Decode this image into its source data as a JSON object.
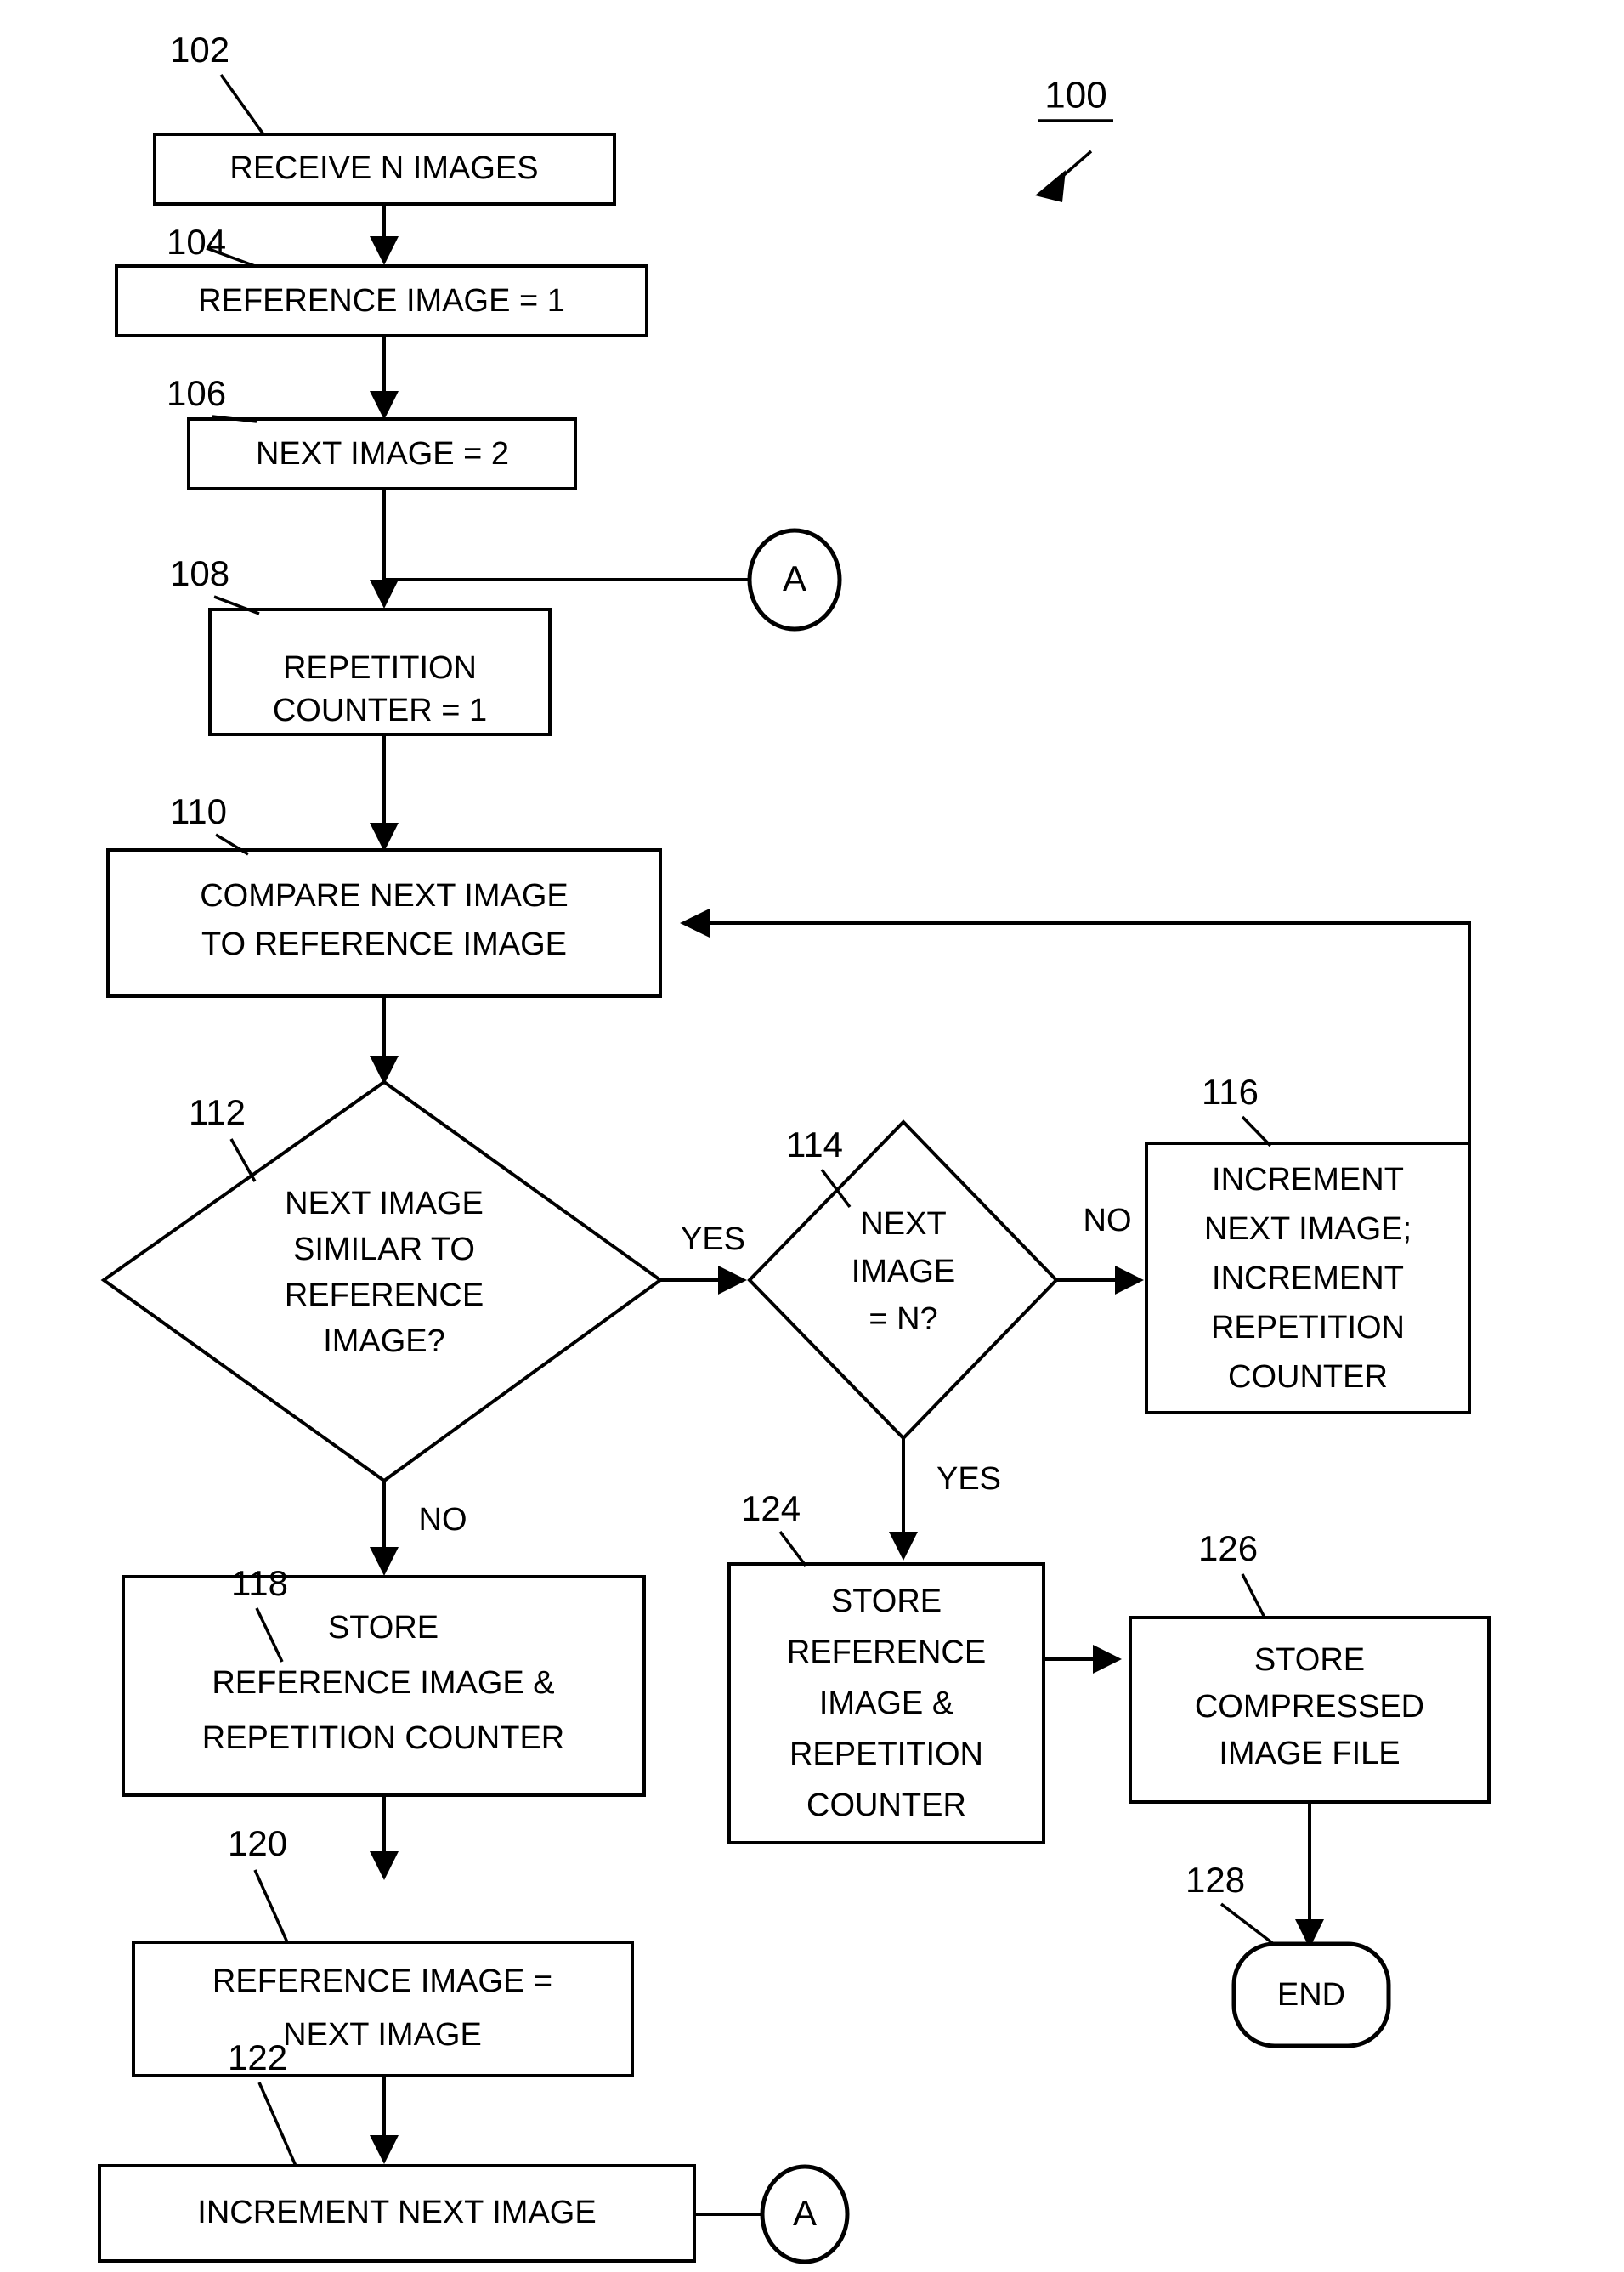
{
  "figure": {
    "number": "100",
    "underline": true
  },
  "nodes": [
    {
      "id": "n102",
      "ref": "102",
      "shape": "process",
      "lines": [
        "RECEIVE N IMAGES"
      ]
    },
    {
      "id": "n104",
      "ref": "104",
      "shape": "process",
      "lines": [
        "REFERENCE IMAGE = 1"
      ]
    },
    {
      "id": "n106",
      "ref": "106",
      "shape": "process",
      "lines": [
        "NEXT IMAGE = 2"
      ]
    },
    {
      "id": "n108",
      "ref": "108",
      "shape": "process",
      "lines": [
        "REPETITION",
        "COUNTER = 1"
      ]
    },
    {
      "id": "n110",
      "ref": "110",
      "shape": "process",
      "lines": [
        "COMPARE NEXT IMAGE",
        "TO REFERENCE IMAGE"
      ]
    },
    {
      "id": "n112",
      "ref": "112",
      "shape": "decision",
      "lines": [
        "NEXT IMAGE",
        "SIMILAR TO",
        "REFERENCE",
        "IMAGE?"
      ]
    },
    {
      "id": "n114",
      "ref": "114",
      "shape": "decision",
      "lines": [
        "NEXT",
        "IMAGE",
        "= N?"
      ]
    },
    {
      "id": "n116",
      "ref": "116",
      "shape": "process",
      "lines": [
        "INCREMENT",
        "NEXT IMAGE;",
        "INCREMENT",
        "REPETITION",
        "COUNTER"
      ]
    },
    {
      "id": "n118",
      "ref": "118",
      "shape": "process",
      "lines": [
        "STORE",
        "REFERENCE IMAGE &",
        "REPETITION COUNTER"
      ]
    },
    {
      "id": "n120",
      "ref": "120",
      "shape": "process",
      "lines": [
        "REFERENCE IMAGE =",
        "NEXT IMAGE"
      ]
    },
    {
      "id": "n122",
      "ref": "122",
      "shape": "process",
      "lines": [
        "INCREMENT NEXT IMAGE"
      ]
    },
    {
      "id": "n124",
      "ref": "124",
      "shape": "process",
      "lines": [
        "STORE",
        "REFERENCE",
        "IMAGE &",
        "REPETITION",
        "COUNTER"
      ]
    },
    {
      "id": "n126",
      "ref": "126",
      "shape": "process",
      "lines": [
        "STORE",
        "COMPRESSED",
        "IMAGE FILE"
      ]
    },
    {
      "id": "n128",
      "ref": "128",
      "shape": "terminator",
      "lines": [
        "END"
      ]
    }
  ],
  "connectors": [
    {
      "id": "connA-top",
      "label": "A"
    },
    {
      "id": "connA-bottom",
      "label": "A"
    }
  ],
  "edge_labels": {
    "d112_yes": "YES",
    "d112_no": "NO",
    "d114_no": "NO",
    "d114_yes": "YES"
  }
}
